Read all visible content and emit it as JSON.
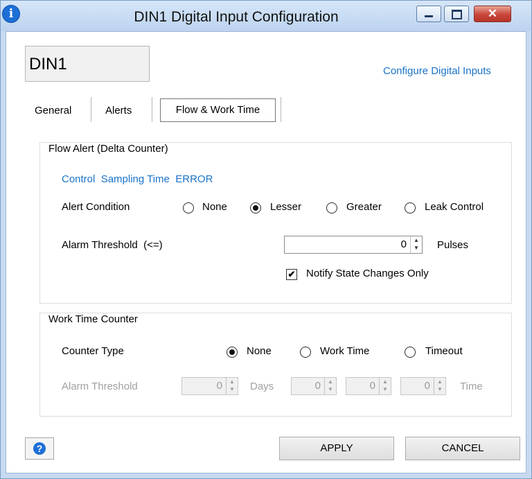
{
  "window": {
    "title": "DIN1 Digital Input Configuration",
    "close_glyph": "✕",
    "info_glyph": "i"
  },
  "header": {
    "input_name": "DIN1",
    "config_link": "Configure Digital Inputs"
  },
  "tabs": [
    {
      "label": "General",
      "active": false
    },
    {
      "label": "Alerts",
      "active": false
    },
    {
      "label": "Flow & Work Time",
      "active": true
    }
  ],
  "flow_alert": {
    "legend": "Flow Alert (Delta Counter)",
    "status": "Control  Sampling Time  ERROR",
    "condition_label": "Alert Condition",
    "options": [
      "None",
      "Lesser",
      "Greater",
      "Leak Control"
    ],
    "selected": "Lesser",
    "threshold_label": "Alarm Threshold  (<=)",
    "threshold_value": "0",
    "threshold_unit": "Pulses",
    "notify_label": "Notify State Changes Only",
    "notify_checked": true
  },
  "work_time": {
    "legend": "Work Time Counter",
    "counter_label": "Counter Type",
    "options": [
      "None",
      "Work Time",
      "Timeout"
    ],
    "selected": "None",
    "threshold_label": "Alarm Threshold",
    "days_value": "0",
    "days_label": "Days",
    "h_value": "0",
    "m_value": "0",
    "s_value": "0",
    "time_label": "Time"
  },
  "footer": {
    "help_glyph": "?",
    "apply_label": "APPLY",
    "cancel_label": "CANCEL"
  },
  "colors": {
    "link": "#1a73c9",
    "titlebar": "#c7daf1",
    "close": "#c9453a"
  }
}
